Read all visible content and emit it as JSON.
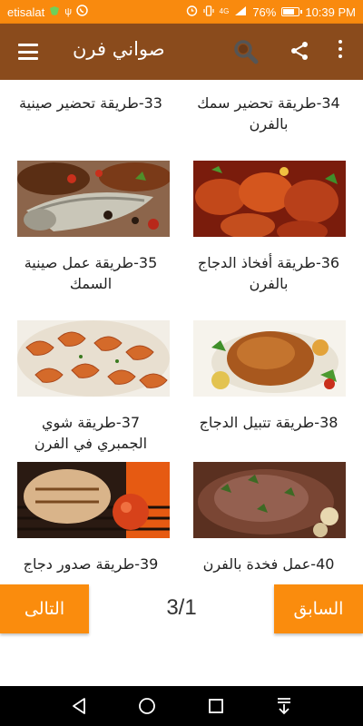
{
  "status_bar": {
    "carrier": "etisalat",
    "network": "4G",
    "battery": "76%",
    "battery_level": 0.76,
    "time": "10:39 PM"
  },
  "app_bar": {
    "title": "صواني فرن",
    "menu_icon": "hamburger-menu-icon",
    "search_icon": "search-icon",
    "share_icon": "share-icon",
    "more_icon": "more-vert-icon"
  },
  "recipes": [
    {
      "title": "33-طريقة تحضير صينية"
    },
    {
      "title": "34-طريقة تحضير سمك بالفرن"
    },
    {
      "title": "35-طريقة عمل صينية السمك",
      "image": "baked-fish"
    },
    {
      "title": "36-طريقة أفخاذ الدجاج بالفرن",
      "image": "chicken-thighs"
    },
    {
      "title": "37-طريقة شوي الجمبري في الفرن",
      "image": "shrimp"
    },
    {
      "title": "38-طريقة تتبيل الدجاج",
      "image": "roast-chicken"
    },
    {
      "title": "39-طريقة صدور دجاج",
      "image": "grilled-chicken"
    },
    {
      "title": "40-عمل فخدة بالفرن",
      "image": "roast-lamb"
    }
  ],
  "pagination": {
    "next_label": "التالى",
    "prev_label": "السابق",
    "page_indicator": "3/1"
  },
  "nav_bar": {
    "back_icon": "back-icon",
    "home_icon": "home-icon",
    "recents_icon": "recents-icon",
    "notifications_icon": "notification-pull-icon"
  },
  "colors": {
    "status_bar": "#f98a0e",
    "app_bar": "#8a4b1c",
    "accent_button": "#fa8c0d"
  }
}
